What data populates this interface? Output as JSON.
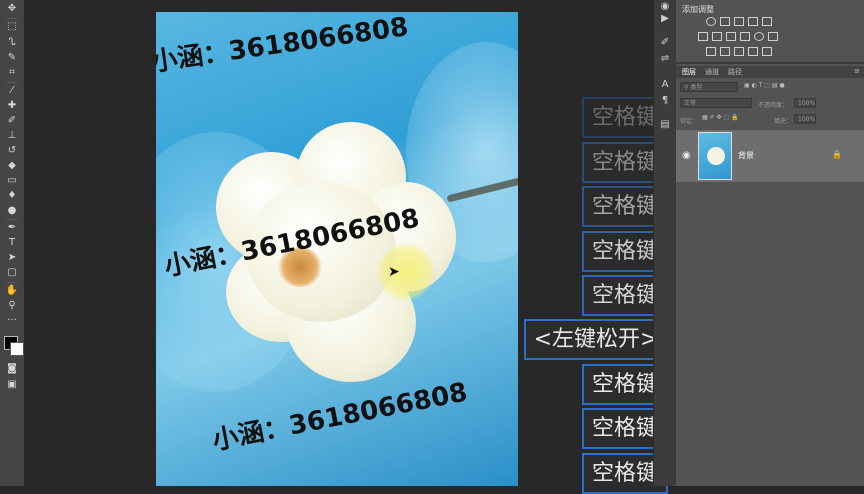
{
  "adjustments_panel": {
    "title": "添加调整"
  },
  "layers_panel": {
    "tabs": [
      "图层",
      "通道",
      "路径"
    ],
    "filter_placeholder": "类型",
    "blend_mode": "正常",
    "opacity_label": "不透明度：",
    "opacity_value": "100%",
    "lock_label": "锁定：",
    "fill_label": "填充：",
    "fill_value": "100%",
    "layers": [
      {
        "name": "背景",
        "visible": true,
        "locked": true
      }
    ]
  },
  "canvas": {
    "watermark_text_1": "小涵：3618066808",
    "watermark_text_2": "小涵：3618066808",
    "watermark_text_3": "小涵：3618066808"
  },
  "key_overlays": [
    {
      "label": "空格键",
      "opacity": 0.35
    },
    {
      "label": "空格键",
      "opacity": 0.5
    },
    {
      "label": "空格键",
      "opacity": 0.65
    },
    {
      "label": "空格键",
      "opacity": 0.85
    },
    {
      "label": "空格键",
      "opacity": 0.9
    },
    {
      "label": "<左键松开>",
      "opacity": 1
    },
    {
      "label": "空格键",
      "opacity": 1
    },
    {
      "label": "空格键",
      "opacity": 1
    },
    {
      "label": "空格键",
      "opacity": 1
    }
  ],
  "colors": {
    "app_bg": "#282828",
    "panel_bg": "#535353",
    "key_border": "#2f6ec7",
    "foreground_color": "#000000",
    "background_color": "#ffffff"
  },
  "tool_icons": [
    "move-icon",
    "marquee-icon",
    "lasso-icon",
    "quick-select-icon",
    "crop-icon",
    "eyedropper-icon",
    "healing-icon",
    "brush-icon",
    "stamp-icon",
    "history-brush-icon",
    "eraser-icon",
    "gradient-icon",
    "blur-icon",
    "dodge-icon",
    "pen-icon",
    "type-icon",
    "path-select-icon",
    "rectangle-icon",
    "hand-icon",
    "zoom-icon",
    "more-tools-icon"
  ]
}
